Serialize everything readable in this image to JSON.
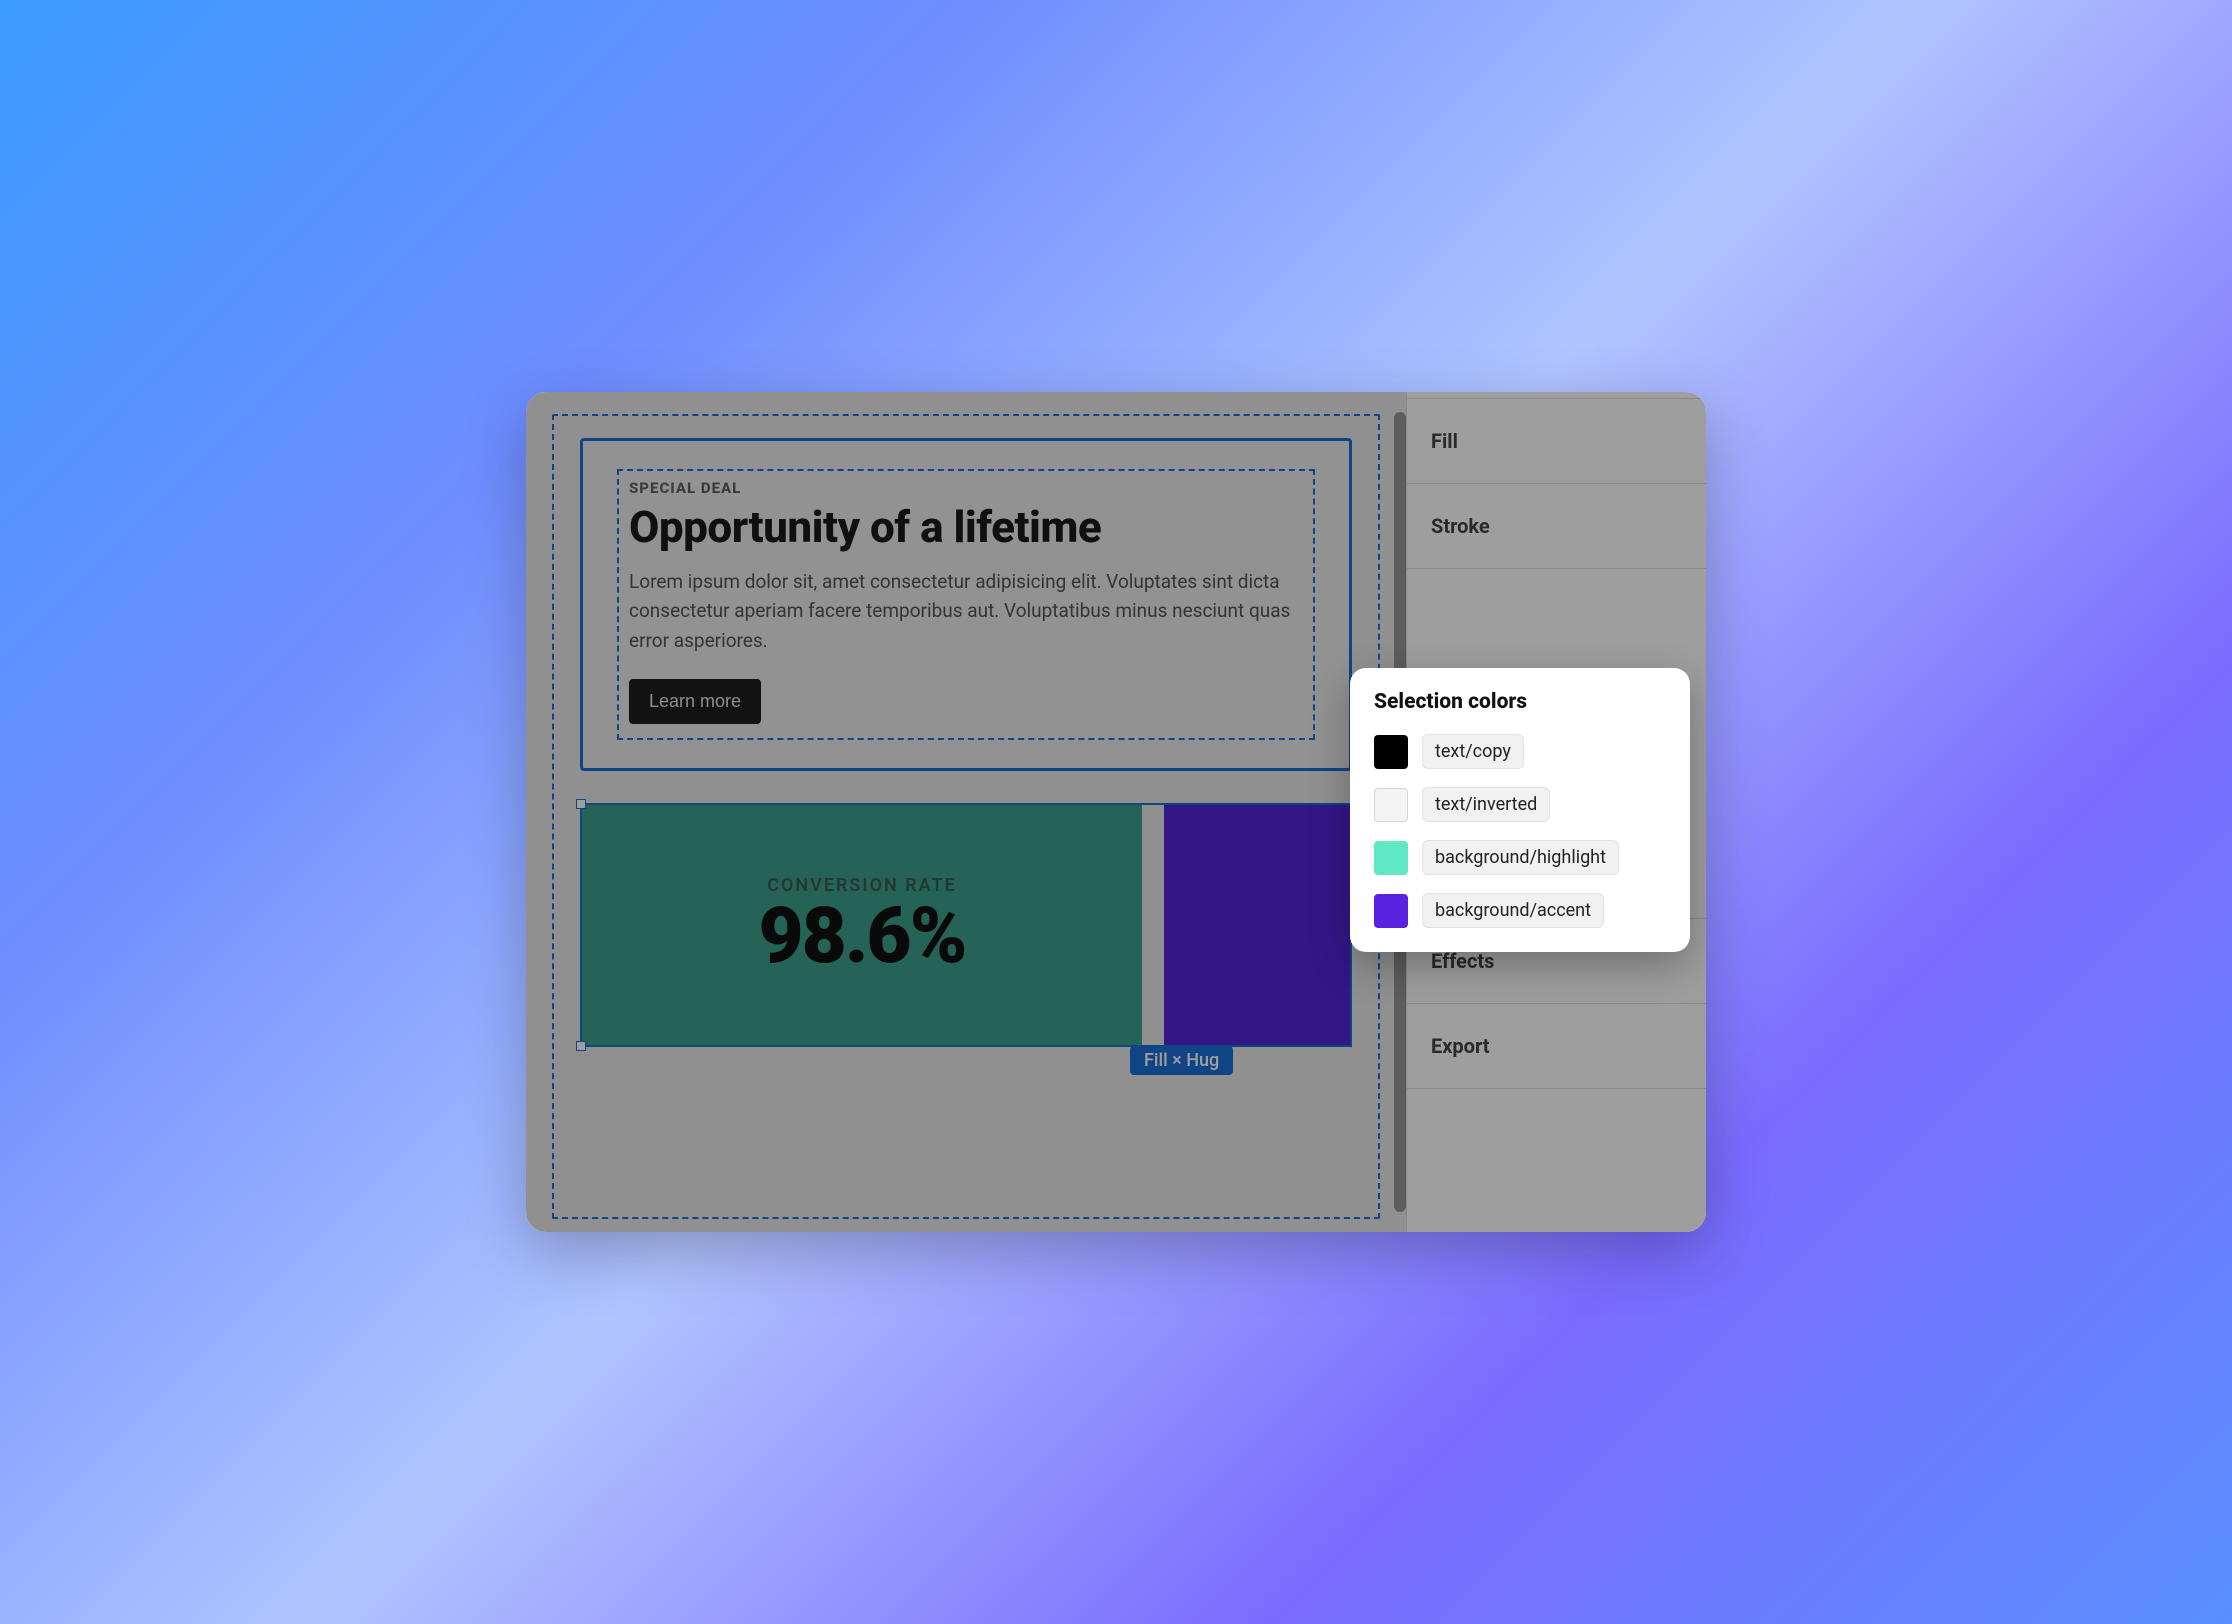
{
  "canvas": {
    "card": {
      "eyebrow": "SPECIAL DEAL",
      "headline": "Opportunity of a lifetime",
      "body": "Lorem ipsum dolor sit, amet consectetur adipisicing elit. Voluptates sint dicta consectetur aperiam facere temporibus aut. Voluptatibus minus nesciunt quas error asperiores.",
      "cta": "Learn more"
    },
    "stat": {
      "label": "CONVERSION RATE",
      "value": "98.6%"
    },
    "size_badge": "Fill × Hug"
  },
  "panel": {
    "sections": {
      "fill": "Fill",
      "stroke": "Stroke",
      "effects": "Effects",
      "export": "Export"
    }
  },
  "popover": {
    "title": "Selection colors",
    "colors": [
      {
        "swatch": "#000000",
        "name": "text/copy"
      },
      {
        "swatch": "#f3f3f3",
        "name": "text/inverted"
      },
      {
        "swatch": "#5ee8c3",
        "name": "background/highlight"
      },
      {
        "swatch": "#5a21e0",
        "name": "background/accent"
      }
    ]
  },
  "palette": {
    "selection_blue": "#1b6fd6",
    "tile_highlight": "#3aa189",
    "tile_accent": "#5126d9"
  }
}
